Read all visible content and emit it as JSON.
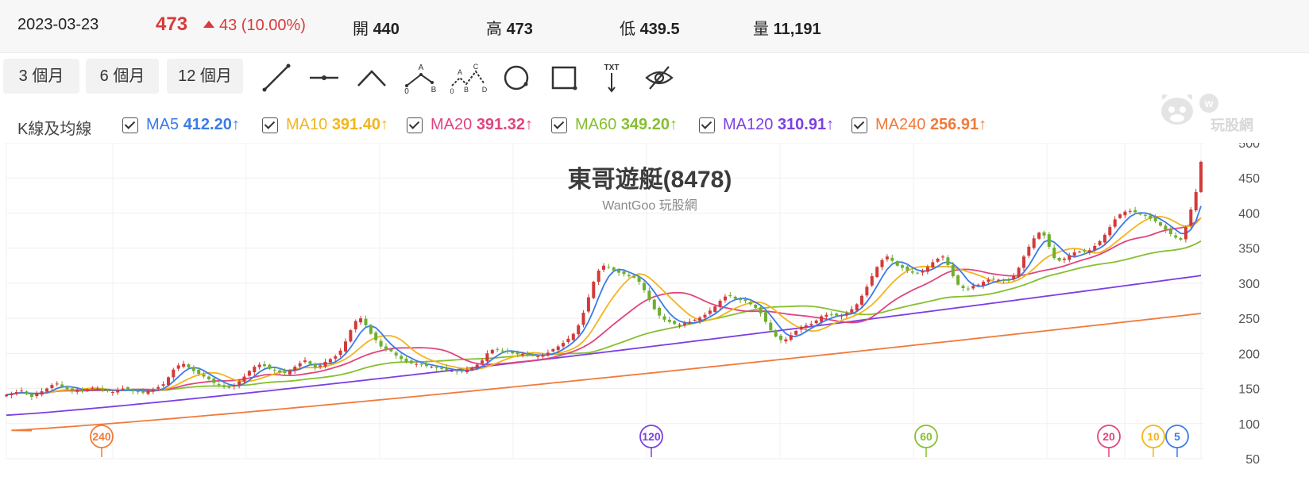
{
  "quote": {
    "date": "2023-03-23",
    "price": "473",
    "change": "43 (10.00%)",
    "open_label": "開",
    "open_value": "440",
    "high_label": "高",
    "high_value": "473",
    "low_label": "低",
    "low_value": "439.5",
    "volume_label": "量",
    "volume_value": "11,191"
  },
  "ranges": [
    "3 個月",
    "6 個月",
    "12 個月"
  ],
  "tools": [
    "line-icon",
    "horizontal-line-icon",
    "angle-icon",
    "abc-pattern-icon",
    "abcd-pattern-icon",
    "circle-icon",
    "rectangle-icon",
    "text-annotation-icon",
    "eye-off-icon"
  ],
  "tool_labels": {
    "txt": "TXT",
    "a": "A",
    "b": "B",
    "c": "C",
    "d": "D",
    "zero": "0"
  },
  "ma_title": "K線及均線",
  "ma": [
    {
      "name": "MA5",
      "value": "412.20",
      "color": "#3a7be8",
      "trend": "↑"
    },
    {
      "name": "MA10",
      "value": "391.40",
      "color": "#f2b51d",
      "trend": "↑"
    },
    {
      "name": "MA20",
      "value": "391.32",
      "color": "#e0447f",
      "trend": "↑"
    },
    {
      "name": "MA60",
      "value": "349.20",
      "color": "#86bf2f",
      "trend": "↑"
    },
    {
      "name": "MA120",
      "value": "310.91",
      "color": "#7b3fe3",
      "trend": "↑"
    },
    {
      "name": "MA240",
      "value": "256.91",
      "color": "#f07a3c",
      "trend": "↑"
    }
  ],
  "logo_text": "玩股網",
  "chart_data": {
    "type": "candlestick",
    "title": "東哥遊艇(8478)",
    "subtitle": "WantGoo 玩股網",
    "ylim": [
      50,
      500
    ],
    "yticks": [
      500,
      450,
      400,
      350,
      300,
      250,
      200,
      150,
      100,
      50
    ],
    "grid": true,
    "up_color": "#d23a3a",
    "down_color": "#6fae2e",
    "close": [
      141,
      143,
      145,
      147,
      142,
      138,
      143,
      146,
      150,
      155,
      157,
      153,
      149,
      147,
      148,
      146,
      149,
      151,
      150,
      147,
      146,
      145,
      148,
      150,
      149,
      146,
      145,
      144,
      147,
      149,
      152,
      156,
      166,
      177,
      183,
      185,
      180,
      175,
      171,
      167,
      163,
      158,
      155,
      152,
      151,
      155,
      160,
      167,
      175,
      181,
      184,
      182,
      178,
      176,
      173,
      172,
      176,
      181,
      186,
      190,
      185,
      180,
      183,
      188,
      192,
      196,
      204,
      217,
      233,
      246,
      250,
      240,
      228,
      219,
      210,
      205,
      203,
      197,
      192,
      188,
      186,
      185,
      184,
      182,
      181,
      179,
      178,
      176,
      175,
      174,
      175,
      177,
      180,
      184,
      190,
      200,
      205,
      206,
      204,
      202,
      200,
      199,
      199,
      198,
      197,
      196,
      197,
      201,
      206,
      210,
      215,
      221,
      228,
      240,
      258,
      280,
      302,
      318,
      325,
      323,
      318,
      315,
      313,
      310,
      308,
      302,
      290,
      276,
      263,
      254,
      248,
      245,
      242,
      241,
      243,
      245,
      248,
      251,
      255,
      261,
      267,
      275,
      281,
      282,
      278,
      276,
      275,
      270,
      265,
      257,
      245,
      233,
      224,
      219,
      220,
      226,
      232,
      238,
      240,
      242,
      247,
      253,
      255,
      255,
      254,
      254,
      257,
      263,
      270,
      282,
      295,
      310,
      323,
      333,
      338,
      332,
      325,
      322,
      318,
      315,
      314,
      318,
      323,
      330,
      335,
      338,
      326,
      310,
      298,
      293,
      292,
      296,
      298,
      302,
      305,
      306,
      305,
      304,
      304,
      310,
      322,
      338,
      352,
      364,
      372,
      368,
      352,
      336,
      332,
      335,
      340,
      344,
      345,
      345,
      347,
      353,
      360,
      369,
      380,
      391,
      398,
      402,
      403,
      401,
      398,
      396,
      392,
      388,
      382,
      376,
      370,
      365,
      362,
      380,
      405,
      430,
      473
    ],
    "ma5_last": 412.2,
    "ma10_last": 391.4,
    "ma20_last": 391.32,
    "ma60_last": 349.2,
    "ma120_last": 310.91,
    "ma240_last": 256.91,
    "ma120_start": 112,
    "ma240_start": 90,
    "markers": [
      {
        "label": "240",
        "color": "#f07a3c"
      },
      {
        "label": "120",
        "color": "#7b3fe3"
      },
      {
        "label": "60",
        "color": "#86bf2f"
      },
      {
        "label": "20",
        "color": "#e0447f"
      },
      {
        "label": "10",
        "color": "#f2b51d"
      },
      {
        "label": "5",
        "color": "#3a7be8"
      }
    ]
  }
}
